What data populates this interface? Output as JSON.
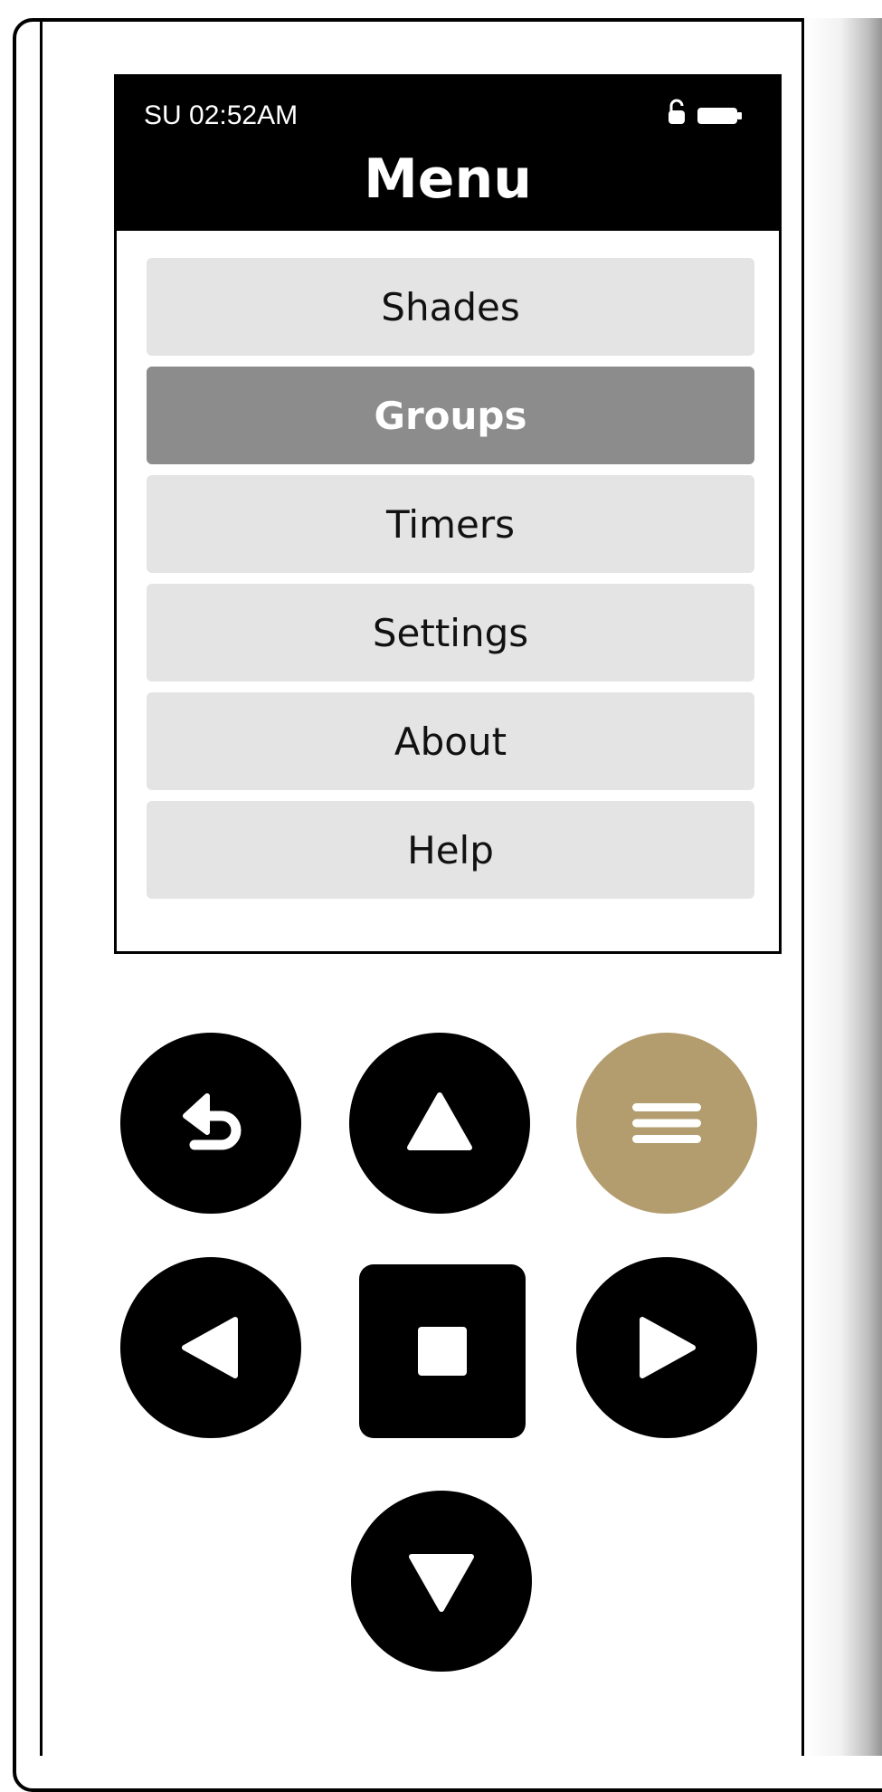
{
  "status": {
    "time": "SU 02:52AM",
    "lock_icon": "unlocked-padlock-icon",
    "battery_icon": "battery-full-icon"
  },
  "header": {
    "title": "Menu"
  },
  "menu": {
    "items": [
      {
        "label": "Shades",
        "selected": false
      },
      {
        "label": "Groups",
        "selected": true
      },
      {
        "label": "Timers",
        "selected": false
      },
      {
        "label": "Settings",
        "selected": false
      },
      {
        "label": "About",
        "selected": false
      },
      {
        "label": "Help",
        "selected": false
      }
    ]
  },
  "controls": {
    "back_icon": "return-arrow-icon",
    "up_icon": "triangle-up-icon",
    "menu_icon": "hamburger-menu-icon",
    "left_icon": "triangle-left-icon",
    "stop_icon": "stop-square-icon",
    "right_icon": "triangle-right-icon",
    "down_icon": "triangle-down-icon"
  },
  "colors": {
    "accent": "#b39d6f",
    "selected_item": "#8c8c8c",
    "item_background": "#e4e4e4",
    "button": "#000000"
  }
}
